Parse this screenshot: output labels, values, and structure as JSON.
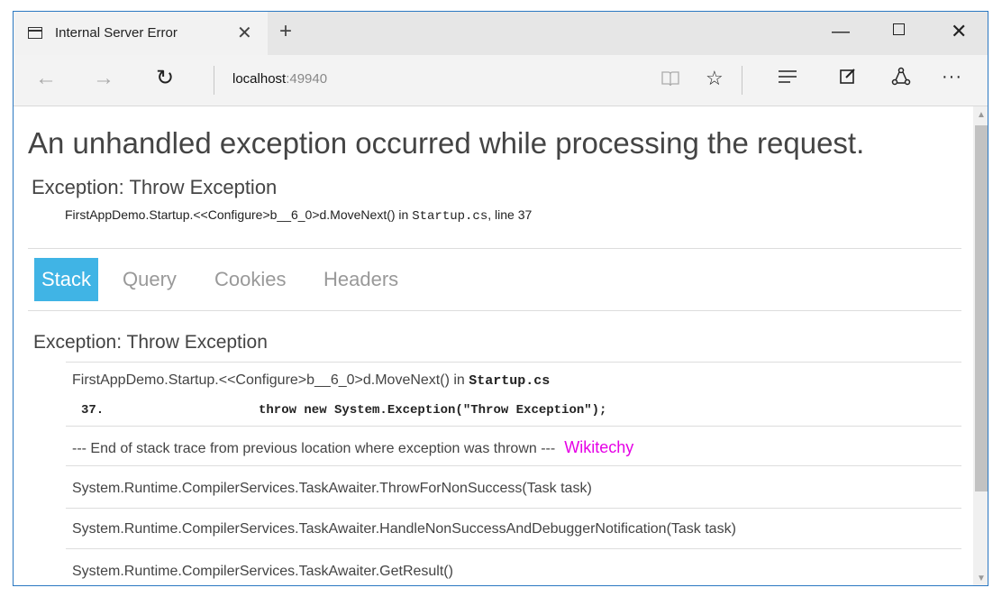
{
  "browser": {
    "tab_title": "Internal Server Error",
    "tab_close": "✕",
    "new_tab": "+",
    "url_host": "localhost",
    "url_port": ":49940",
    "controls": {
      "minimize": "—",
      "close": "✕"
    },
    "more": "···"
  },
  "page": {
    "heading": "An unhandled exception occurred while processing the request.",
    "exception_title": "Exception: Throw Exception",
    "exception_location_prefix": "FirstAppDemo.Startup.<<Configure>b__6_0>d.MoveNext() in ",
    "exception_location_file": "Startup.cs",
    "exception_location_suffix": ", line 37",
    "tabs": [
      {
        "label": "Stack"
      },
      {
        "label": "Query"
      },
      {
        "label": "Cookies"
      },
      {
        "label": "Headers"
      }
    ],
    "stack": {
      "title": "Exception: Throw Exception",
      "frame1_prefix": "FirstAppDemo.Startup.<<Configure>b__6_0>d.MoveNext() in ",
      "frame1_file": "Startup.cs",
      "code_line_no": "37.",
      "code_line": "throw new System.Exception(\"Throw Exception\");",
      "end_of_trace": "--- End of stack trace from previous location where exception was thrown ---",
      "watermark": "Wikitechy",
      "frames": [
        "System.Runtime.CompilerServices.TaskAwaiter.ThrowForNonSuccess(Task task)",
        "System.Runtime.CompilerServices.TaskAwaiter.HandleNonSuccessAndDebuggerNotification(Task task)",
        "System.Runtime.CompilerServices.TaskAwaiter.GetResult()"
      ]
    }
  },
  "colors": {
    "accent": "#40b4e5",
    "watermark": "#e600e6",
    "frame": "#2b78c2"
  }
}
